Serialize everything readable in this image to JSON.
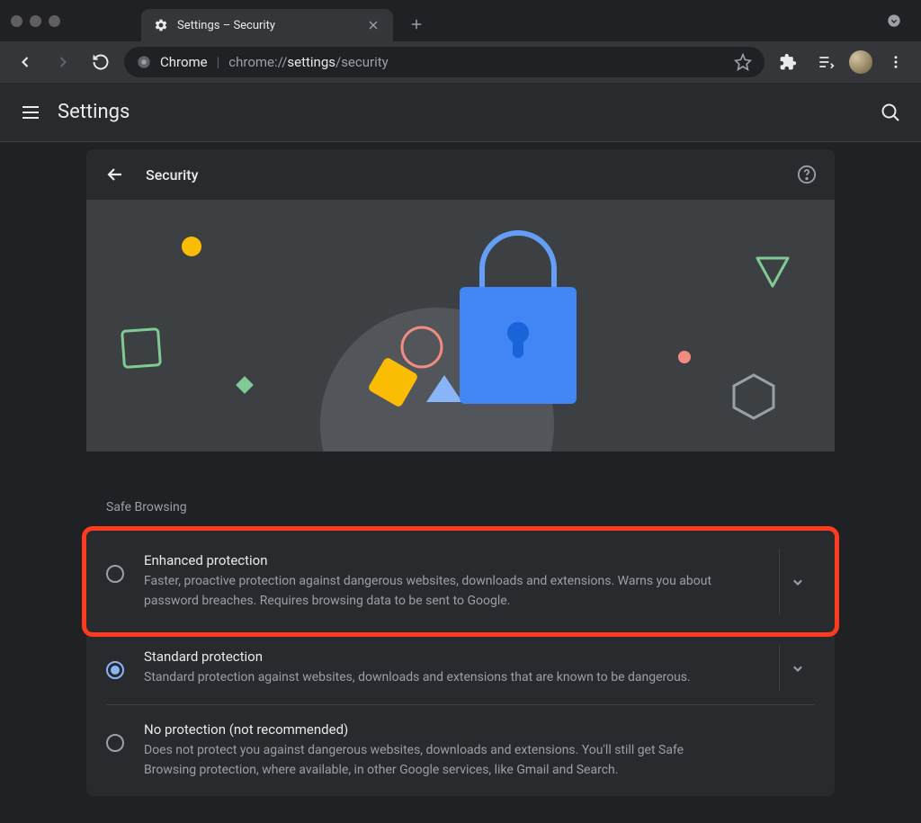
{
  "window": {
    "tab_title": "Settings – Security"
  },
  "toolbar": {
    "url_app": "Chrome",
    "url_scheme": "chrome://",
    "url_strong": "settings",
    "url_rest": "/security"
  },
  "header": {
    "title": "Settings"
  },
  "section": {
    "title": "Security",
    "group_label": "Safe Browsing",
    "options": [
      {
        "title": "Enhanced protection",
        "desc": "Faster, proactive protection against dangerous websites, downloads and extensions. Warns you about password breaches. Requires browsing data to be sent to Google.",
        "selected": false,
        "expandable": true,
        "highlighted": true
      },
      {
        "title": "Standard protection",
        "desc": "Standard protection against websites, downloads and extensions that are known to be dangerous.",
        "selected": true,
        "expandable": true,
        "highlighted": false
      },
      {
        "title": "No protection (not recommended)",
        "desc": "Does not protect you against dangerous websites, downloads and extensions. You'll still get Safe Browsing protection, where available, in other Google services, like Gmail and Search.",
        "selected": false,
        "expandable": false,
        "highlighted": false
      }
    ]
  }
}
